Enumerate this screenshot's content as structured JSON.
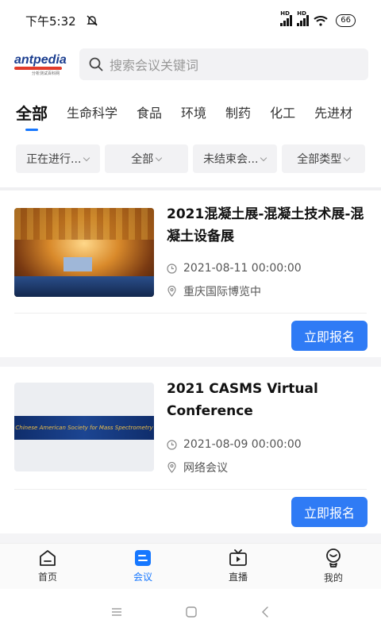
{
  "status_bar": {
    "time": "下午5:32",
    "net_1": "HD",
    "net_2": "HD",
    "battery": "66"
  },
  "header": {
    "logo_text": "antpedia",
    "logo_sub": "分析测试百科网",
    "search_placeholder": "搜索会议关键词"
  },
  "tabs": [
    {
      "label": "全部",
      "active": true
    },
    {
      "label": "生命科学"
    },
    {
      "label": "食品"
    },
    {
      "label": "环境"
    },
    {
      "label": "制药"
    },
    {
      "label": "化工"
    },
    {
      "label": "先进材"
    }
  ],
  "filters": [
    {
      "label": "正在进行..."
    },
    {
      "label": "全部"
    },
    {
      "label": "未结束会..."
    },
    {
      "label": "全部类型"
    }
  ],
  "conferences": [
    {
      "title": "2021混凝土展-混凝土技术展-混凝土设备展",
      "date": "2021-08-11 00:00:00",
      "location": "重庆国际博览中",
      "button": "立即报名"
    },
    {
      "title": "2021 CASMS Virtual Conference",
      "banner_text": "Chinese American Society for Mass Spectrometry",
      "date": "2021-08-09 00:00:00",
      "location": "网络会议",
      "button": "立即报名"
    }
  ],
  "bottom_nav": [
    {
      "label": "首页",
      "icon": "home-icon"
    },
    {
      "label": "会议",
      "icon": "meeting-icon",
      "active": true
    },
    {
      "label": "直播",
      "icon": "live-tv-icon"
    },
    {
      "label": "我的",
      "icon": "profile-icon"
    }
  ],
  "colors": {
    "accent": "#1677ff",
    "button": "#2f7bf5"
  }
}
